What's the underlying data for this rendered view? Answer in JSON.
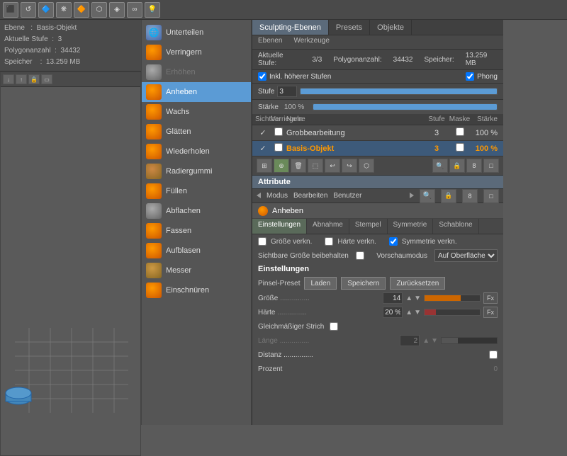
{
  "topTabs": {
    "sculpting": "Sculpting-Ebenen",
    "presets": "Presets",
    "objekte": "Objekte"
  },
  "subTabs": {
    "ebenen": "Ebenen",
    "werkzeuge": "Werkzeuge"
  },
  "statusBar": {
    "aktuelleStufeLbl": "Aktuelle Stufe:",
    "aktuelleStufVal": "3/3",
    "polygonanzahlLbl": "Polygonanzahl:",
    "polygonanzahlVal": "34432",
    "speicherLbl": "Speicher:",
    "speicherVal": "13.259 MB"
  },
  "checkboxRow": {
    "inkl": "Inkl. höherer Stufen",
    "phong": "Phong"
  },
  "stufeLbl": "Stufe",
  "stufeVal": "3",
  "stärke": {
    "label": "Stärke",
    "value": "100 %"
  },
  "layerTable": {
    "headers": [
      "Sichtbar",
      "Verriegeln",
      "Name",
      "Stufe",
      "Maske",
      "Stärke"
    ],
    "rows": [
      {
        "name": "Grobbearbeitung",
        "stufe": "3",
        "staerke": "100 %",
        "selected": false
      },
      {
        "name": "Basis-Objekt",
        "stufe": "3",
        "staerke": "100 %",
        "selected": true,
        "orange": true
      }
    ]
  },
  "toolbarIcons": [
    "⊞",
    "⊕",
    "🗑",
    "⬚",
    "↩",
    "↪",
    "⬡"
  ],
  "attribute": "Attribute",
  "modebar": {
    "modus": "Modus",
    "bearbeiten": "Bearbeiten",
    "benutzer": "Benutzer"
  },
  "sectionHeading": "Anheben",
  "settingsTabs": [
    "Einstellungen",
    "Abnahme",
    "Stempel",
    "Symmetrie",
    "Schablone"
  ],
  "activeSettingsTab": "Einstellungen",
  "settingsRows": {
    "groesseVerkn": "Größe verkn.",
    "haerteVerkn": "Härte verkn.",
    "symmetrieVerkn": "Symmetrie verkn.",
    "sichtbareGroesse": "Sichtbare Größe beibehalten",
    "vorschaumodus": "Vorschaumodus",
    "vorschauVal": "Auf Oberfläche"
  },
  "einstellungen": "Einstellungen",
  "pinselPreset": {
    "label": "Pinsel-Preset",
    "laden": "Laden",
    "speichern": "Speichern",
    "zuruecksetzen": "Zurücksetzen"
  },
  "params": {
    "groesse": {
      "label": "Größe",
      "dots": "...............",
      "value": "14"
    },
    "haerte": {
      "label": "Härte",
      "dots": "...............",
      "value": "20 %"
    }
  },
  "gleichmaessigerStrich": {
    "label": "Gleichmäßiger Strich"
  },
  "laenge": {
    "label": "Länge",
    "dots": "...............",
    "value": "2"
  },
  "distanz": {
    "label": "Distanz",
    "dots": "..............."
  },
  "prozent": {
    "label": "Prozent",
    "value": "0"
  },
  "leftInfo": {
    "ebeneLbl": "Ebene",
    "ebeneVal": "Basis-Objekt",
    "aktuelleStufeLbl": "Aktuelle Stufe",
    "aktuelleStufVal": "3",
    "polygonanzahlLbl": "Polygonanzahl",
    "polygonanzahlVal": "34432",
    "speicherLbl": "Speicher",
    "speicherVal": "13.259 MB"
  },
  "toolMenu": {
    "items": [
      {
        "label": "Unterteilen",
        "iconType": "globe",
        "active": false
      },
      {
        "label": "Verringern",
        "iconType": "orange",
        "active": false
      },
      {
        "label": "Erhöhen",
        "iconType": "gray",
        "active": false,
        "disabled": true
      },
      {
        "label": "Anheben",
        "iconType": "orange",
        "active": true
      },
      {
        "label": "Wachs",
        "iconType": "orange",
        "active": false
      },
      {
        "label": "Glätten",
        "iconType": "orange",
        "active": false
      },
      {
        "label": "Wiederholen",
        "iconType": "orange",
        "active": false
      },
      {
        "label": "Radiergummi",
        "iconType": "orange",
        "active": false
      },
      {
        "label": "Füllen",
        "iconType": "orange",
        "active": false
      },
      {
        "label": "Abflachen",
        "iconType": "orange",
        "active": false
      },
      {
        "label": "Fassen",
        "iconType": "orange",
        "active": false
      },
      {
        "label": "Aufblasen",
        "iconType": "orange",
        "active": false
      },
      {
        "label": "Messer",
        "iconType": "orange",
        "active": false
      },
      {
        "label": "Einschnüren",
        "iconType": "orange",
        "active": false
      }
    ]
  }
}
